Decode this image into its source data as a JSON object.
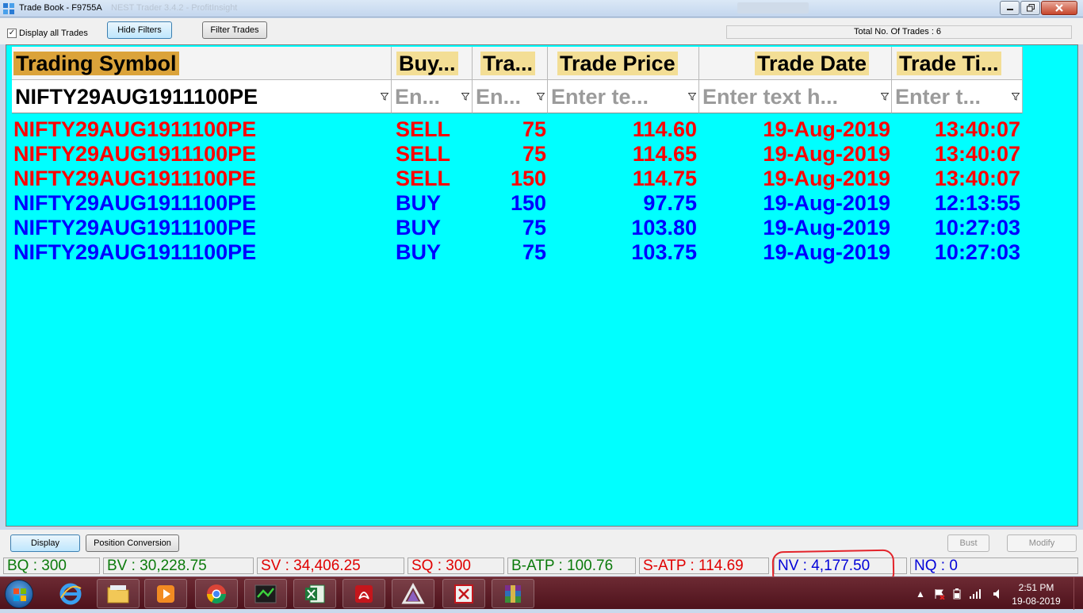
{
  "window": {
    "title": "Trade Book - F9755A",
    "background_title": "NEST Trader 3.4.2 - ProfitInsight"
  },
  "toolbar": {
    "display_all_label": "Display all Trades",
    "display_all_checked": true,
    "hide_filters_label": "Hide Filters",
    "filter_trades_label": "Filter Trades",
    "total_trades_text": "Total No. Of Trades : 6"
  },
  "grid": {
    "columns": [
      "Trading Symbol",
      "Buy...",
      "Tra...",
      "Trade Price",
      "Trade Date",
      "Trade Ti..."
    ],
    "filters": {
      "symbol_value": "NIFTY29AUG1911100PE",
      "buysell_placeholder": "En...",
      "qty_placeholder": "En...",
      "price_placeholder": "Enter te...",
      "date_placeholder": "Enter text h...",
      "time_placeholder": "Enter t..."
    },
    "rows": [
      {
        "symbol": "NIFTY29AUG1911100PE",
        "side": "SELL",
        "qty": "75",
        "price": "114.60",
        "date": "19-Aug-2019",
        "time": "13:40:07"
      },
      {
        "symbol": "NIFTY29AUG1911100PE",
        "side": "SELL",
        "qty": "75",
        "price": "114.65",
        "date": "19-Aug-2019",
        "time": "13:40:07"
      },
      {
        "symbol": "NIFTY29AUG1911100PE",
        "side": "SELL",
        "qty": "150",
        "price": "114.75",
        "date": "19-Aug-2019",
        "time": "13:40:07"
      },
      {
        "symbol": "NIFTY29AUG1911100PE",
        "side": "BUY",
        "qty": "150",
        "price": "97.75",
        "date": "19-Aug-2019",
        "time": "12:13:55"
      },
      {
        "symbol": "NIFTY29AUG1911100PE",
        "side": "BUY",
        "qty": "75",
        "price": "103.80",
        "date": "19-Aug-2019",
        "time": "10:27:03"
      },
      {
        "symbol": "NIFTY29AUG1911100PE",
        "side": "BUY",
        "qty": "75",
        "price": "103.75",
        "date": "19-Aug-2019",
        "time": "10:27:03"
      }
    ]
  },
  "buttons": {
    "display_label": "Display",
    "position_conversion_label": "Position Conversion",
    "bust_label": "Bust",
    "modify_label": "Modify"
  },
  "status": {
    "bq": "BQ : 300",
    "bv": "BV : 30,228.75",
    "sv": "SV : 34,406.25",
    "sq": "SQ : 300",
    "batp": "B-ATP : 100.76",
    "satp": "S-ATP : 114.69",
    "nv": "NV : 4,177.50",
    "nq": "NQ : 0"
  },
  "taskbar": {
    "apps": [
      "start-orb",
      "internet-explorer",
      "file-explorer",
      "media-player",
      "chrome",
      "trading-terminal",
      "excel",
      "pdf-reader",
      "autodesk",
      "pdf-editor",
      "winrar"
    ],
    "time": "2:51 PM",
    "date": "19-08-2019"
  },
  "colors": {
    "grid_bg": "#00ffff",
    "sell_text": "#ff0000",
    "buy_text": "#0000ff",
    "symbol_header": "#dba33a",
    "header_label": "#f3de95",
    "taskbar": "#5a1a24",
    "annotation": "#e3242b"
  }
}
